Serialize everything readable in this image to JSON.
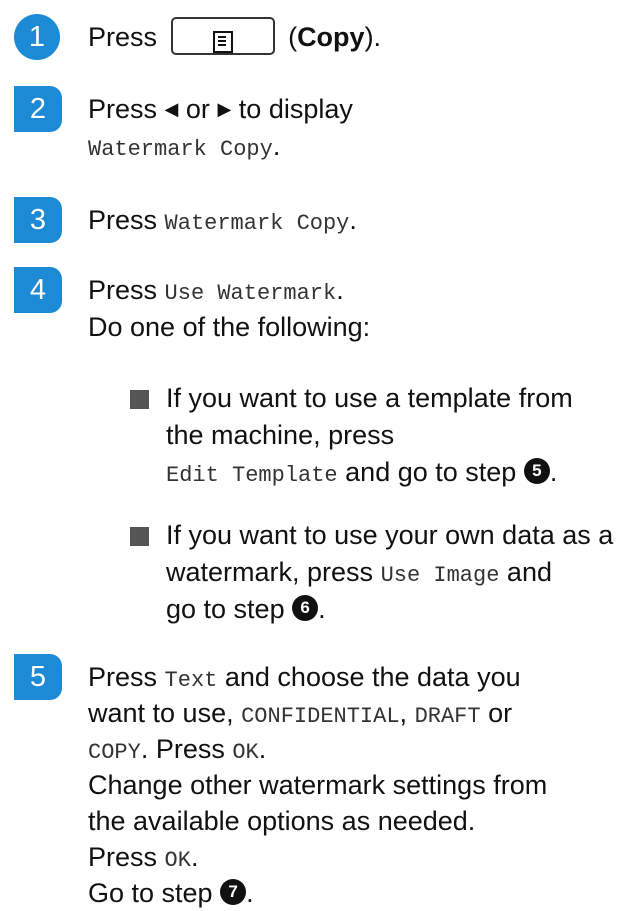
{
  "steps": [
    {
      "num": "1",
      "press": "Press",
      "copy_label": "Copy",
      "open_paren": "(",
      "close_paren": ")."
    },
    {
      "num": "2",
      "text_a": "Press",
      "left_arrow": "◀",
      "or": "or",
      "right_arrow": "▶",
      "text_b": "to display",
      "mono": "Watermark Copy",
      "period": "."
    },
    {
      "num": "3",
      "text": "Press",
      "mono": "Watermark Copy",
      "period": "."
    },
    {
      "num": "4",
      "text": "Press",
      "mono": "Use Watermark",
      "period": ".",
      "line2": "Do one of the following:"
    },
    {
      "num": "5"
    }
  ],
  "bullets": [
    {
      "line1": "If you want to use a template from",
      "line2": "the machine, press",
      "mono": "Edit Template",
      "after": "and go to step",
      "ref": "5",
      "period": "."
    },
    {
      "line1": "If you want to use your own data as a",
      "line2a": "watermark, press",
      "mono": "Use Image",
      "line2b": "and",
      "line3": "go to step",
      "ref": "6",
      "period": "."
    }
  ],
  "step5": {
    "l1a": "Press",
    "l1mono": "Text",
    "l1b": "and choose the data you",
    "l2a": "want to use,",
    "l2m1": "CONFIDENTIAL",
    "l2comma": ",",
    "l2m2": "DRAFT",
    "l2b": "or",
    "l3m": "COPY",
    "l3a": ". Press",
    "l3m2": "OK",
    "l3b": ".",
    "l4": "Change other watermark settings from",
    "l5": "the available options as needed.",
    "l6a": "Press",
    "l6m": "OK",
    "l6b": ".",
    "l7a": "Go to step",
    "l7ref": "7",
    "l7b": "."
  }
}
